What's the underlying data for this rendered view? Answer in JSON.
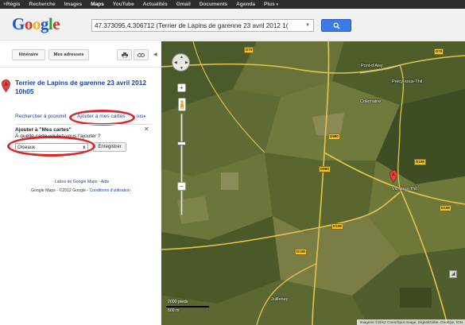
{
  "topbar": {
    "items": [
      {
        "label": "+Régis"
      },
      {
        "label": "Recherche"
      },
      {
        "label": "Images"
      },
      {
        "label": "Maps",
        "active": true
      },
      {
        "label": "YouTube"
      },
      {
        "label": "Actualités"
      },
      {
        "label": "Gmail"
      },
      {
        "label": "Documents"
      },
      {
        "label": "Agenda"
      },
      {
        "label": "Plus"
      }
    ]
  },
  "header": {
    "logo_text": "Google",
    "search_value": "47.373095,4.306712 (Terrier de Lapins de garenne 23 avril 2012 1(",
    "search_icon": "magnifier-icon"
  },
  "panel": {
    "toolbar": {
      "itineraire_label": "Itinéraire",
      "mes_adresses_label": "Mes adresses",
      "print_icon": "print-icon",
      "link_icon": "link-icon",
      "collapse_icon": "chevron-left-icon"
    },
    "place": {
      "marker_letter": "A",
      "title": "Terrier de Lapins de garenne 23 avril 2012 10h05"
    },
    "actions": {
      "search_nearby": "Rechercher à proximit",
      "add_to_maps": "Ajouter à mes cartes",
      "more": "lus"
    },
    "add_box": {
      "title": "Ajouter à \"Mes cartes\"",
      "question": "À quelle carte voulez-vous l'ajouter ?",
      "select_value": "Oiseaux",
      "save_label": "Enregistrer",
      "close_icon": "close-icon"
    },
    "footer": {
      "labs": "- Labos de Google Maps - Aide",
      "copyright": "Google Maps - ©2012 Google - ",
      "terms": "Conditions d'utilisation"
    }
  },
  "map": {
    "marker_letter": "A",
    "labels": [
      {
        "text": "Pont-d'Aisy"
      },
      {
        "text": "Précy-sous-Thil"
      },
      {
        "text": "Colemaine"
      },
      {
        "text": "Vic-sous-Thil"
      },
      {
        "text": "Juilleney"
      }
    ],
    "roads": [
      "D70",
      "D70",
      "D108",
      "D108",
      "D980",
      "D980",
      "D108",
      "D108"
    ],
    "scale": {
      "top": "2000 pieds",
      "bottom": "500 m"
    },
    "attribution": "Imagerie ©2012 Cnes/Spot Image, DigitalGlobe, GeoEye, IGN"
  }
}
